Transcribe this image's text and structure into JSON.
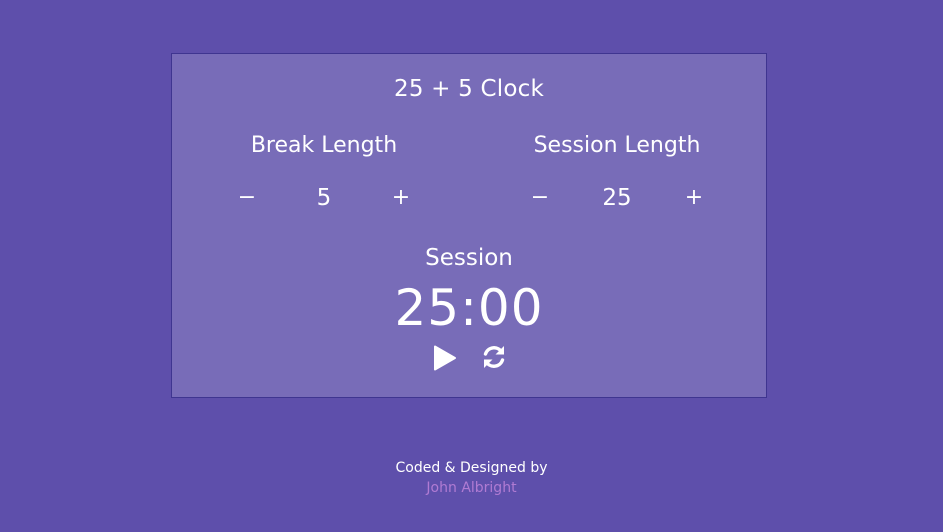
{
  "app": {
    "title": "25 + 5 Clock"
  },
  "break": {
    "label": "Break Length",
    "decrement": "−",
    "value": "5",
    "increment": "+"
  },
  "session": {
    "label": "Session Length",
    "decrement": "−",
    "value": "25",
    "increment": "+"
  },
  "timer": {
    "label": "Session",
    "time": "25:00",
    "play_icon": "play-icon",
    "reset_icon": "refresh-icon"
  },
  "footer": {
    "credit": "Coded & Designed by",
    "author": "John Albright"
  },
  "colors": {
    "background": "#5e4fab",
    "card": "#786cb8",
    "card_border": "#3f3590",
    "text": "#ffffff",
    "author_link": "#b07bd3"
  }
}
